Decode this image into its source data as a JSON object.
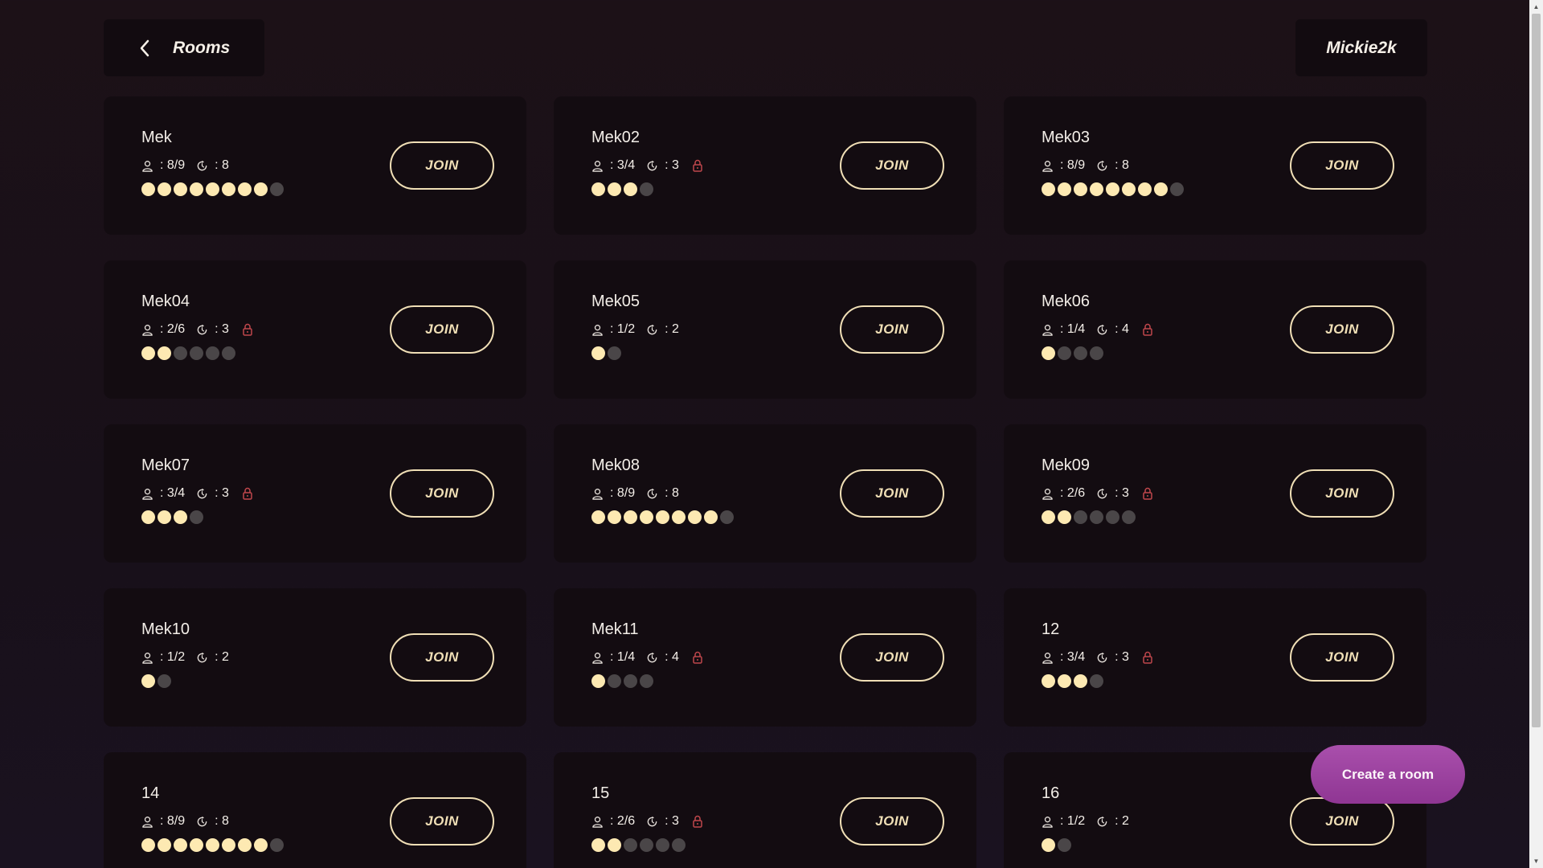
{
  "header": {
    "back_icon": "chevron-left-icon",
    "title": "Rooms",
    "username": "Mickie2k"
  },
  "join_label": "JOIN",
  "create_room_label": "Create a room",
  "colors": {
    "background": "#1a1118",
    "card": "#130c11",
    "accent_gold": "#f0dfb6",
    "dot_filled": "#fde9b2",
    "dot_empty": "#4a4648",
    "lock_red": "#c0474c",
    "create_button": "#a14aa5"
  },
  "rooms": [
    {
      "name": "Mek",
      "players": ": 8/9",
      "rounds": ": 8",
      "locked": false,
      "filled": 8,
      "capacity": 9
    },
    {
      "name": "Mek02",
      "players": ": 3/4",
      "rounds": ": 3",
      "locked": true,
      "filled": 3,
      "capacity": 4
    },
    {
      "name": "Mek03",
      "players": ": 8/9",
      "rounds": ": 8",
      "locked": false,
      "filled": 8,
      "capacity": 9
    },
    {
      "name": "Mek04",
      "players": ": 2/6",
      "rounds": ": 3",
      "locked": true,
      "filled": 2,
      "capacity": 6
    },
    {
      "name": "Mek05",
      "players": ": 1/2",
      "rounds": ": 2",
      "locked": false,
      "filled": 1,
      "capacity": 2
    },
    {
      "name": "Mek06",
      "players": ": 1/4",
      "rounds": ": 4",
      "locked": true,
      "filled": 1,
      "capacity": 4
    },
    {
      "name": "Mek07",
      "players": ": 3/4",
      "rounds": ": 3",
      "locked": true,
      "filled": 3,
      "capacity": 4
    },
    {
      "name": "Mek08",
      "players": ": 8/9",
      "rounds": ": 8",
      "locked": false,
      "filled": 8,
      "capacity": 9
    },
    {
      "name": "Mek09",
      "players": ": 2/6",
      "rounds": ": 3",
      "locked": true,
      "filled": 2,
      "capacity": 6
    },
    {
      "name": "Mek10",
      "players": ": 1/2",
      "rounds": ": 2",
      "locked": false,
      "filled": 1,
      "capacity": 2
    },
    {
      "name": "Mek11",
      "players": ": 1/4",
      "rounds": ": 4",
      "locked": true,
      "filled": 1,
      "capacity": 4
    },
    {
      "name": "12",
      "players": ": 3/4",
      "rounds": ": 3",
      "locked": true,
      "filled": 3,
      "capacity": 4
    },
    {
      "name": "14",
      "players": ": 8/9",
      "rounds": ": 8",
      "locked": false,
      "filled": 8,
      "capacity": 9
    },
    {
      "name": "15",
      "players": ": 2/6",
      "rounds": ": 3",
      "locked": true,
      "filled": 2,
      "capacity": 6
    },
    {
      "name": "16",
      "players": ": 1/2",
      "rounds": ": 2",
      "locked": false,
      "filled": 1,
      "capacity": 2
    }
  ]
}
